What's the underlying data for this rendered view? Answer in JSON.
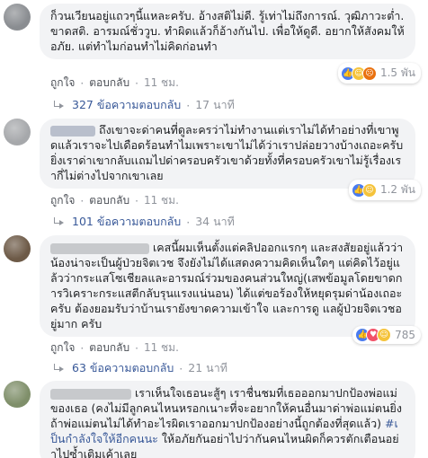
{
  "comments": [
    {
      "text": "ก็วนเวียนอยู่แถวๆนี้แหละครับ. อ้างสติไม่ดี. รู้เท่าไม่ถึงการณ์. วุฒิภาวะต่ำ. ขาดสติ. อารมณ์ชั่ววูบ. ทำผิดแล้วก็อ้างกันไป. เพื่อให้ดูดี. อยากให้สังคมให้อภัย. แต่ทำไมก่อนทำไม่คิดก่อนทำ",
      "like_label": "ถูกใจ",
      "reply_label": "ตอบกลับ",
      "time": "11 ชม.",
      "reaction_count": "1.5 พัน",
      "replies_text": "327 ข้อความตอบกลับ",
      "replies_time": "17 นาที"
    },
    {
      "text": "ถึงเขาจะด่าคนที่ดูละครว่าไม่ทำงานแต่เราไม่ได้ทำอย่างที่เขาพูดแล้วเราจะไปเดือดร้อนทำไมเพราะเขาไม่ได้ว่าเราปล่อยวางบ้างเถอะครับยิ่งเราด่าเขากลับเเถมไปด่าครอบครัวเขาด้วยทั้งที่ครอบครัวเขาไม่รู้เรื่องเรากี่ไม่ต่างไปจากเขาเลย",
      "like_label": "ถูกใจ",
      "reply_label": "ตอบกลับ",
      "time": "11 ชม.",
      "reaction_count": "1.2 พัน",
      "replies_text": "101 ข้อความตอบกลับ",
      "replies_time": "34 นาที"
    },
    {
      "text": "เคสนี้ผมเห็นตั้งแต่คลิปออกแรกๆ และสงสัยอยู่แล้วว่าน้องน่าจะเป็นผู้ป่วยจิตเวช จึงยังไม่ได้แสดงความคิดเห็นใดๆ แต่คิดไว้อยู่แล้วว่ากระแสโซเชียลและอารมณ์ร่วมของคนส่วนใหญ่(เสพข้อมูลโดยขาดการวิเคราะกระแสตีกลับรุนแรงแน่นอน) ได้แต่ขอร้องให้หยุดรุมด่าน้องเถอะครับ ต้องยอมรับว่าบ้านเรายังขาดความเข้าใจ และการดู แลผู้ป่วยจิตเวชอยู่มาก ครับ",
      "like_label": "ถูกใจ",
      "reply_label": "ตอบกลับ",
      "time": "11 ชม.",
      "reaction_count": "785",
      "replies_text": "63 ข้อความตอบกลับ",
      "replies_time": "21 นาที"
    },
    {
      "text_before": "เราเห็นใจเธอนะสู้ๆ เราชื่นชมที่เธอออกมาปกป้องพ่อแม่ของเธอ (คงไม่มีลูกคนไหนหรอกเนาะที่จะอยากให้คนอื่นมาด่าพ่อแม่ตนยิ่งถ้าพ่อแม่ตนไม่ได้ทำอะไรผิดเราออกมาปกป้องอย่างนี้ถูกต้องที่สุดแล้ว) ",
      "hashtag": "#เป็นกำลังใจให้อีกคนนะ",
      "text_after": " ให้อภัยกันอย่าไปว่ากันคนไหนผิดก็ควรตักเตือนอย่าไปซ้ำเติมเค้าเลย"
    }
  ],
  "colors": {
    "link": "#385898",
    "bubble": "#f2f3f5",
    "meta": "#90949c"
  }
}
